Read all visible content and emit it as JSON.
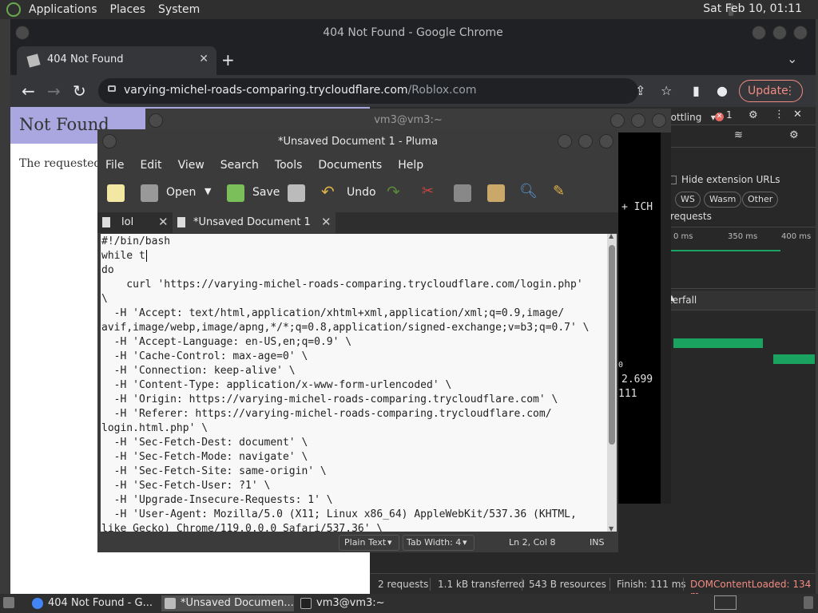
{
  "top_panel": {
    "menus": [
      "Applications",
      "Places",
      "System"
    ],
    "clock": "Sat Feb 10, 01:11"
  },
  "chrome": {
    "window_title": "404 Not Found - Google Chrome",
    "tab_title": "404 Not Found",
    "url_host": "varying-michel-roads-comparing.trycloudflare.com",
    "url_path": "/Roblox.com",
    "update_label": "Update"
  },
  "page": {
    "heading": "Not Found",
    "text": "The requested r"
  },
  "devtools": {
    "error_count": "1",
    "throttle": "rottling",
    "hide_ext_urls": "Hide extension URLs",
    "chips": [
      "WS",
      "Wasm",
      "Other"
    ],
    "requests_label": "requests",
    "ticks": [
      "0 ms",
      "350 ms",
      "400 ms"
    ],
    "waterfall": "terfall",
    "status": {
      "requests": "2 requests",
      "transferred": "1.1 kB transferred",
      "resources": "543 B resources",
      "finish": "Finish: 111 ms",
      "dcl": "DOMContentLoaded: 134 m"
    },
    "colors": {
      "dcl": "#f28b82",
      "timing": "#1aa260"
    }
  },
  "terminal": {
    "title": "vm3@vm3:~",
    "fragments": [
      "+ ICH",
      "0",
      "2.699",
      "111"
    ]
  },
  "pluma": {
    "title": "*Unsaved Document 1 - Pluma",
    "menus": [
      "File",
      "Edit",
      "View",
      "Search",
      "Tools",
      "Documents",
      "Help"
    ],
    "toolbar": {
      "open": "Open",
      "save": "Save",
      "undo": "Undo"
    },
    "tabs": [
      "lol",
      "*Unsaved Document 1"
    ],
    "code": "#!/bin/bash\nwhile t\ndo\n    curl 'https://varying-michel-roads-comparing.trycloudflare.com/login.php'\n\\\n  -H 'Accept: text/html,application/xhtml+xml,application/xml;q=0.9,image/\navif,image/webp,image/apng,*/*;q=0.8,application/signed-exchange;v=b3;q=0.7' \\\n  -H 'Accept-Language: en-US,en;q=0.9' \\\n  -H 'Cache-Control: max-age=0' \\\n  -H 'Connection: keep-alive' \\\n  -H 'Content-Type: application/x-www-form-urlencoded' \\\n  -H 'Origin: https://varying-michel-roads-comparing.trycloudflare.com' \\\n  -H 'Referer: https://varying-michel-roads-comparing.trycloudflare.com/\nlogin.html.php' \\\n  -H 'Sec-Fetch-Dest: document' \\\n  -H 'Sec-Fetch-Mode: navigate' \\\n  -H 'Sec-Fetch-Site: same-origin' \\\n  -H 'Sec-Fetch-User: ?1' \\\n  -H 'Upgrade-Insecure-Requests: 1' \\\n  -H 'User-Agent: Mozilla/5.0 (X11; Linux x86_64) AppleWebKit/537.36 (KHTML,\nlike Gecko) Chrome/119.0.0.0 Safari/537.36' \\",
    "status": {
      "lang": "Plain Text",
      "tab_width": "Tab Width:  4",
      "position": "Ln 2, Col 8",
      "mode": "INS"
    }
  },
  "taskbar": {
    "items": [
      "404 Not Found - G...",
      "*Unsaved Documen...",
      "vm3@vm3:~"
    ]
  }
}
